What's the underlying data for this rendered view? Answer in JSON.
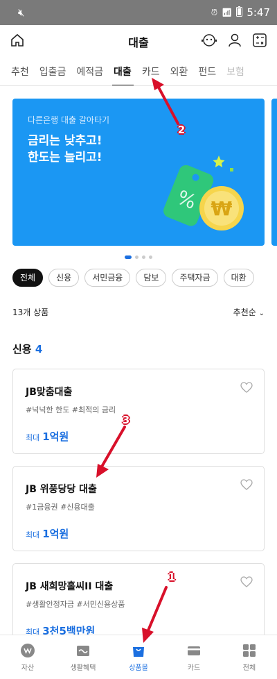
{
  "status": {
    "time": "5:47"
  },
  "header": {
    "title": "대출"
  },
  "tabs": [
    {
      "label": "추천"
    },
    {
      "label": "입출금"
    },
    {
      "label": "예적금"
    },
    {
      "label": "대출"
    },
    {
      "label": "카드"
    },
    {
      "label": "외환"
    },
    {
      "label": "펀드"
    },
    {
      "label": "보험"
    }
  ],
  "banner": {
    "eyebrow": "다른은행 대출 갈아타기",
    "line1": "금리는 낮추고!",
    "line2": "한도는 늘리고!"
  },
  "filters": [
    {
      "label": "전체"
    },
    {
      "label": "신용"
    },
    {
      "label": "서민금융"
    },
    {
      "label": "담보"
    },
    {
      "label": "주택자금"
    },
    {
      "label": "대환"
    }
  ],
  "list": {
    "count": "13개 상품",
    "sort": "추천순"
  },
  "section": {
    "title": "신용",
    "count": "4"
  },
  "products": [
    {
      "name": "JB맞춤대출",
      "tags": "#넉넉한 한도 #최적의 금리",
      "limit_label": "최대",
      "limit": "1억원"
    },
    {
      "name": "JB 위풍당당 대출",
      "tags": "#1금융권 #신용대출",
      "limit_label": "최대",
      "limit": "1억원"
    },
    {
      "name": "JB 새희망홀씨II 대출",
      "tags": "#생활안정자금 #서민신용상품",
      "limit_label": "최대",
      "limit": "3천5백만원"
    }
  ],
  "bottom_nav": [
    {
      "label": "자산"
    },
    {
      "label": "생활혜택"
    },
    {
      "label": "상품몰"
    },
    {
      "label": "카드"
    },
    {
      "label": "전체"
    }
  ],
  "annotations": {
    "a1": "1",
    "a2": "2",
    "a3": "3"
  },
  "colors": {
    "accent": "#1b6fe0",
    "banner": "#1b97f3",
    "annotation": "#d8102a"
  }
}
